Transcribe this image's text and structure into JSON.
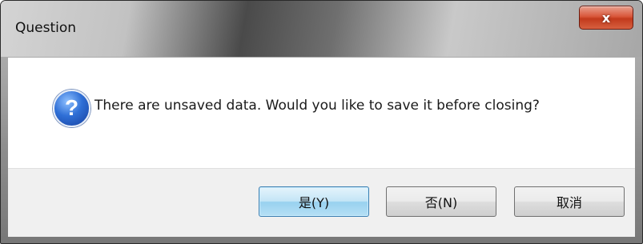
{
  "window": {
    "title": "Question",
    "close_label": "x"
  },
  "dialog": {
    "icon": "question-icon",
    "icon_glyph": "?",
    "message": "There are unsaved data. Would you like to save it before closing?"
  },
  "buttons": {
    "yes_label": "是(Y)",
    "no_label": "否(N)",
    "cancel_label": "取消"
  },
  "colors": {
    "default_button": "#c4e5f6",
    "close_button": "#c23a1c",
    "icon_blue": "#2f6fd6"
  }
}
